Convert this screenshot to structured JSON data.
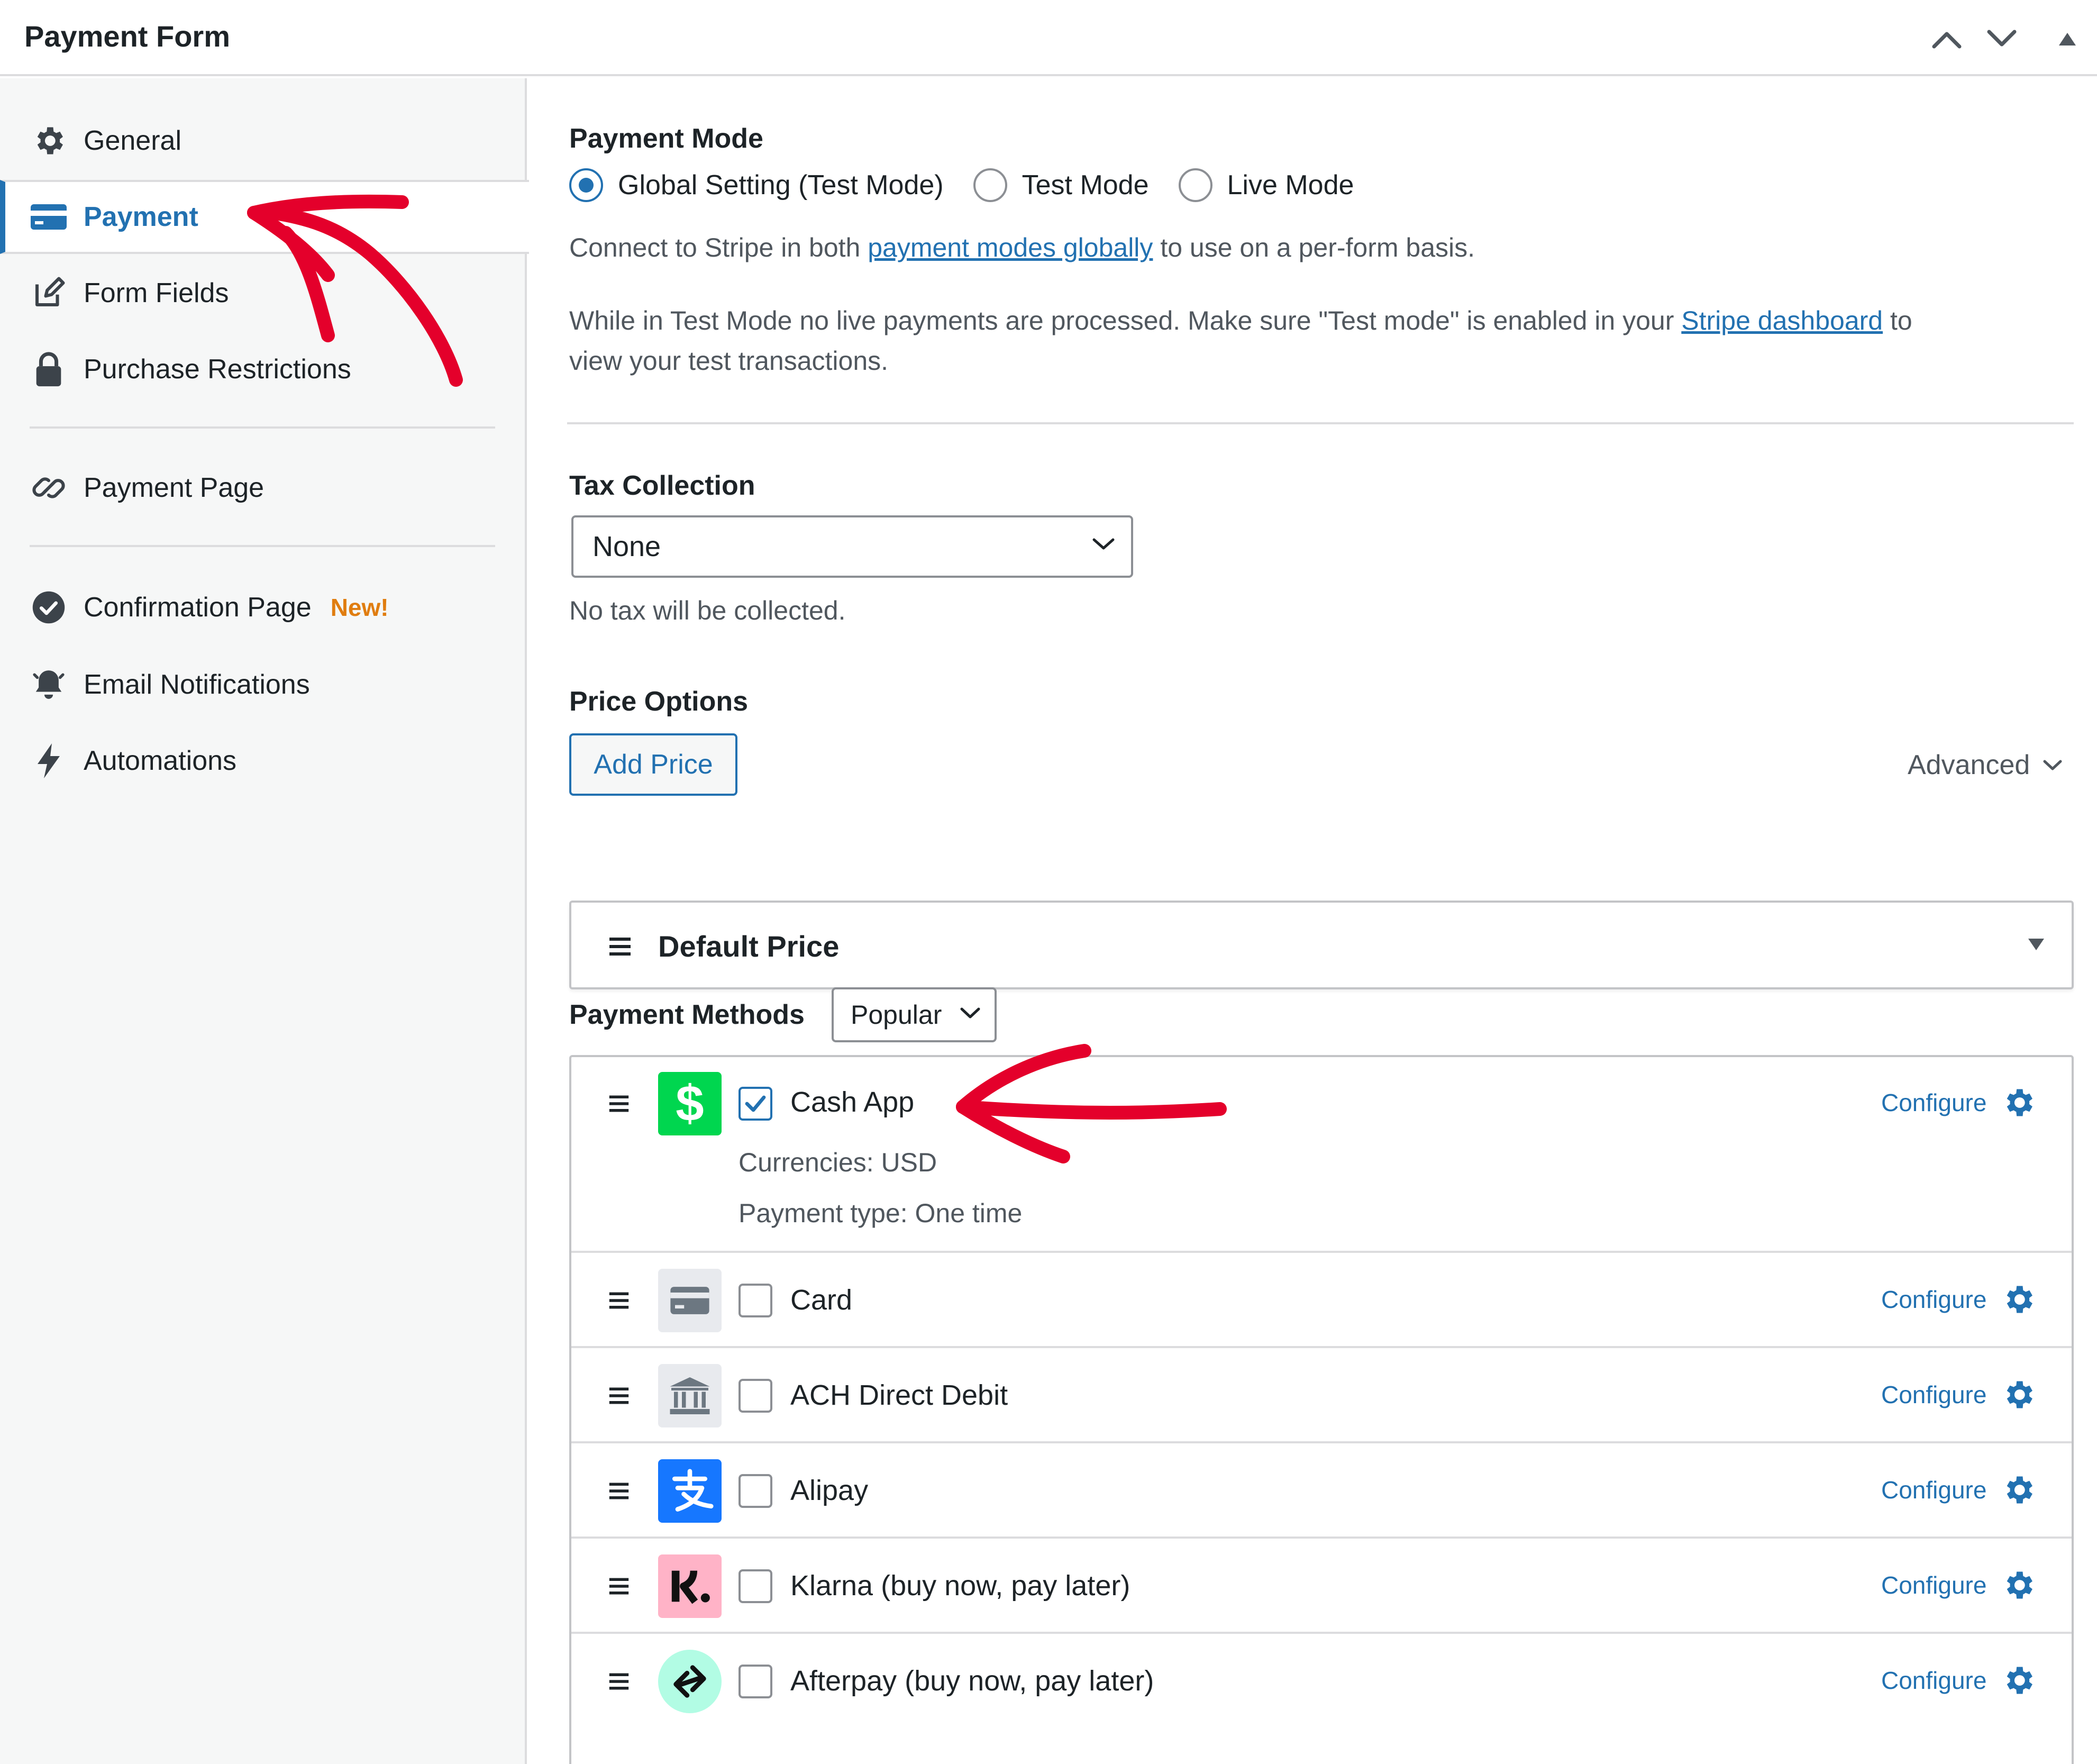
{
  "header": {
    "title": "Payment Form"
  },
  "sidebar": {
    "items": [
      {
        "label": "General",
        "icon": "gear-icon"
      },
      {
        "label": "Payment",
        "icon": "credit-card-icon",
        "active": true
      },
      {
        "label": "Form Fields",
        "icon": "edit-icon"
      },
      {
        "label": "Purchase Restrictions",
        "icon": "lock-icon"
      },
      {
        "label": "Payment Page",
        "icon": "link-icon"
      },
      {
        "label": "Confirmation Page",
        "icon": "check-circle-icon",
        "badge": "New!"
      },
      {
        "label": "Email Notifications",
        "icon": "bell-icon"
      },
      {
        "label": "Automations",
        "icon": "lightning-icon"
      }
    ]
  },
  "payment_mode": {
    "title": "Payment Mode",
    "options": [
      {
        "label": "Global Setting (Test Mode)",
        "checked": true
      },
      {
        "label": "Test Mode",
        "checked": false
      },
      {
        "label": "Live Mode",
        "checked": false
      }
    ],
    "note_prefix": "Connect to Stripe in both ",
    "note_link": "payment modes globally",
    "note_suffix": " to use on a per-form basis.",
    "test_note_prefix": "While in Test Mode no live payments are processed. Make sure \"Test mode\" is enabled in your ",
    "test_note_link": "Stripe dashboard",
    "test_note_suffix": " to",
    "test_note_line2": "view your test transactions."
  },
  "tax": {
    "title": "Tax Collection",
    "selected": "None",
    "help": "No tax will be collected."
  },
  "price_options": {
    "title": "Price Options",
    "add_button": "Add Price",
    "advanced": "Advanced",
    "default_price": "Default Price"
  },
  "payment_methods": {
    "title": "Payment Methods",
    "filter": "Popular",
    "configure_label": "Configure",
    "items": [
      {
        "name": "Cash App",
        "checked": true,
        "currencies": "Currencies: USD",
        "payment_type": "Payment type: One time",
        "logo_color": "#00d64f"
      },
      {
        "name": "Card",
        "checked": false,
        "logo_color": "#e8eaee"
      },
      {
        "name": "ACH Direct Debit",
        "checked": false,
        "logo_color": "#e8eaee"
      },
      {
        "name": "Alipay",
        "checked": false,
        "logo_color": "#1677ff"
      },
      {
        "name": "Klarna (buy now, pay later)",
        "checked": false,
        "logo_color": "#ffb3c7"
      },
      {
        "name": "Afterpay (buy now, pay later)",
        "checked": false,
        "logo_color": "#b2fce4"
      }
    ]
  },
  "colors": {
    "accent": "#2271b1",
    "annotation": "#e4002b",
    "badge": "#e07d10"
  }
}
